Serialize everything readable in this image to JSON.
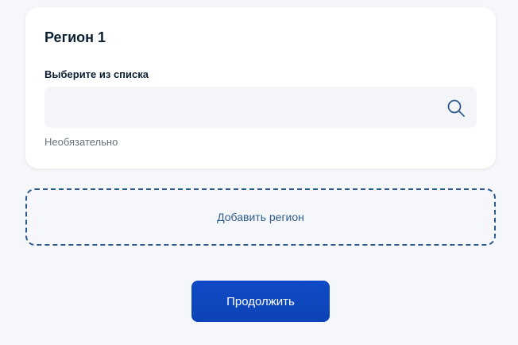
{
  "region_card": {
    "title": "Регион 1",
    "field_label": "Выберите из списка",
    "search_value": "",
    "search_placeholder": "",
    "hint": "Необязательно",
    "search_icon": "search-icon"
  },
  "add_region": {
    "label": "Добавить регион"
  },
  "continue_button": {
    "label": "Продолжить"
  },
  "colors": {
    "page_background": "#f5f7fa",
    "card_background": "#ffffff",
    "field_background": "#f4f5f8",
    "primary_button": "#0d4cd3",
    "link_text": "#2f5d8e",
    "dashed_border": "#2d5a8c",
    "hint_text": "#66727f",
    "title_text": "#0b1f33"
  }
}
